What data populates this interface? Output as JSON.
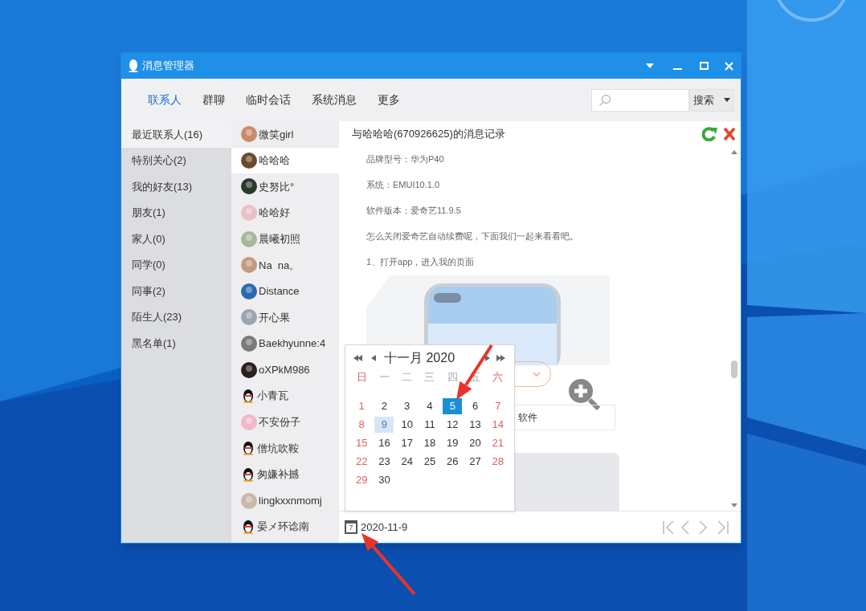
{
  "window": {
    "title": "消息管理器"
  },
  "tabs": [
    {
      "label": "联系人",
      "selected": true
    },
    {
      "label": "群聊",
      "selected": false
    },
    {
      "label": "临时会话",
      "selected": false
    },
    {
      "label": "系统消息",
      "selected": false
    },
    {
      "label": "更多",
      "selected": false
    }
  ],
  "search": {
    "button": "搜索"
  },
  "groups": [
    {
      "label": "最近联系人(16)",
      "selected": true
    },
    {
      "label": "特别关心(2)",
      "selected": false
    },
    {
      "label": "我的好友(13)",
      "selected": false
    },
    {
      "label": "朋友(1)",
      "selected": false
    },
    {
      "label": "家人(0)",
      "selected": false
    },
    {
      "label": "同学(0)",
      "selected": false
    },
    {
      "label": "同事(2)",
      "selected": false
    },
    {
      "label": "陌生人(23)",
      "selected": false
    },
    {
      "label": "黑名单(1)",
      "selected": false
    }
  ],
  "contacts": [
    {
      "name": "微笑girl",
      "selected": false
    },
    {
      "name": "哈哈哈",
      "selected": true
    },
    {
      "name": "史努比°",
      "selected": false
    },
    {
      "name": "哈哈好",
      "selected": false
    },
    {
      "name": "晨曦初照",
      "selected": false
    },
    {
      "name": "Na  na。",
      "selected": false
    },
    {
      "name": "Distance",
      "selected": false
    },
    {
      "name": "开心果",
      "selected": false
    },
    {
      "name": "Baekhyunne:4",
      "selected": false
    },
    {
      "name": "oXPkM986",
      "selected": false
    },
    {
      "name": "小青瓦",
      "selected": false,
      "kind": "penguin"
    },
    {
      "name": "不安份子",
      "selected": false
    },
    {
      "name": "僧坑吹鞍",
      "selected": false,
      "kind": "penguin"
    },
    {
      "name": "匆嫌补撼",
      "selected": false,
      "kind": "penguin"
    },
    {
      "name": "lingkxxnmomj",
      "selected": false
    },
    {
      "name": "晏メ环谂南",
      "selected": false,
      "kind": "penguin"
    }
  ],
  "history": {
    "title": "与哈哈哈(670926625)的消息记录",
    "lines": [
      "品牌型号：华为P40",
      "系统：EMUI10.1.0",
      "软件版本：爱奇艺11.9.5",
      "怎么关闭爱奇艺自动续费呢，下面我们一起来看看吧。",
      "1、打开app，进入我的页面"
    ],
    "card_text": "软件"
  },
  "calendar": {
    "month": "十一月 2020",
    "weekdays": [
      "日",
      "一",
      "二",
      "三",
      "四",
      "五",
      "六"
    ],
    "days": [
      {
        "label": "1",
        "selected": false,
        "current": false
      },
      {
        "label": "2",
        "selected": false,
        "current": false
      },
      {
        "label": "3",
        "selected": false,
        "current": false
      },
      {
        "label": "4",
        "selected": false,
        "current": false
      },
      {
        "label": "5",
        "selected": true,
        "current": false
      },
      {
        "label": "6",
        "selected": false,
        "current": false
      },
      {
        "label": "7",
        "selected": false,
        "current": false
      },
      {
        "label": "8",
        "selected": false,
        "current": false
      },
      {
        "label": "9",
        "selected": false,
        "current": true
      },
      {
        "label": "10",
        "selected": false,
        "current": false
      },
      {
        "label": "11",
        "selected": false,
        "current": false
      },
      {
        "label": "12",
        "selected": false,
        "current": false
      },
      {
        "label": "13",
        "selected": false,
        "current": false
      },
      {
        "label": "14",
        "selected": false,
        "current": false
      },
      {
        "label": "15",
        "selected": false,
        "current": false
      },
      {
        "label": "16",
        "selected": false,
        "current": false
      },
      {
        "label": "17",
        "selected": false,
        "current": false
      },
      {
        "label": "18",
        "selected": false,
        "current": false
      },
      {
        "label": "19",
        "selected": false,
        "current": false
      },
      {
        "label": "20",
        "selected": false,
        "current": false
      },
      {
        "label": "21",
        "selected": false,
        "current": false
      },
      {
        "label": "22",
        "selected": false,
        "current": false
      },
      {
        "label": "23",
        "selected": false,
        "current": false
      },
      {
        "label": "24",
        "selected": false,
        "current": false
      },
      {
        "label": "25",
        "selected": false,
        "current": false
      },
      {
        "label": "26",
        "selected": false,
        "current": false
      },
      {
        "label": "27",
        "selected": false,
        "current": false
      },
      {
        "label": "28",
        "selected": false,
        "current": false
      },
      {
        "label": "29",
        "selected": false,
        "current": false
      },
      {
        "label": "30",
        "selected": false,
        "current": false
      }
    ]
  },
  "footer": {
    "calendar_icon": "7",
    "date": "2020-11-9"
  }
}
